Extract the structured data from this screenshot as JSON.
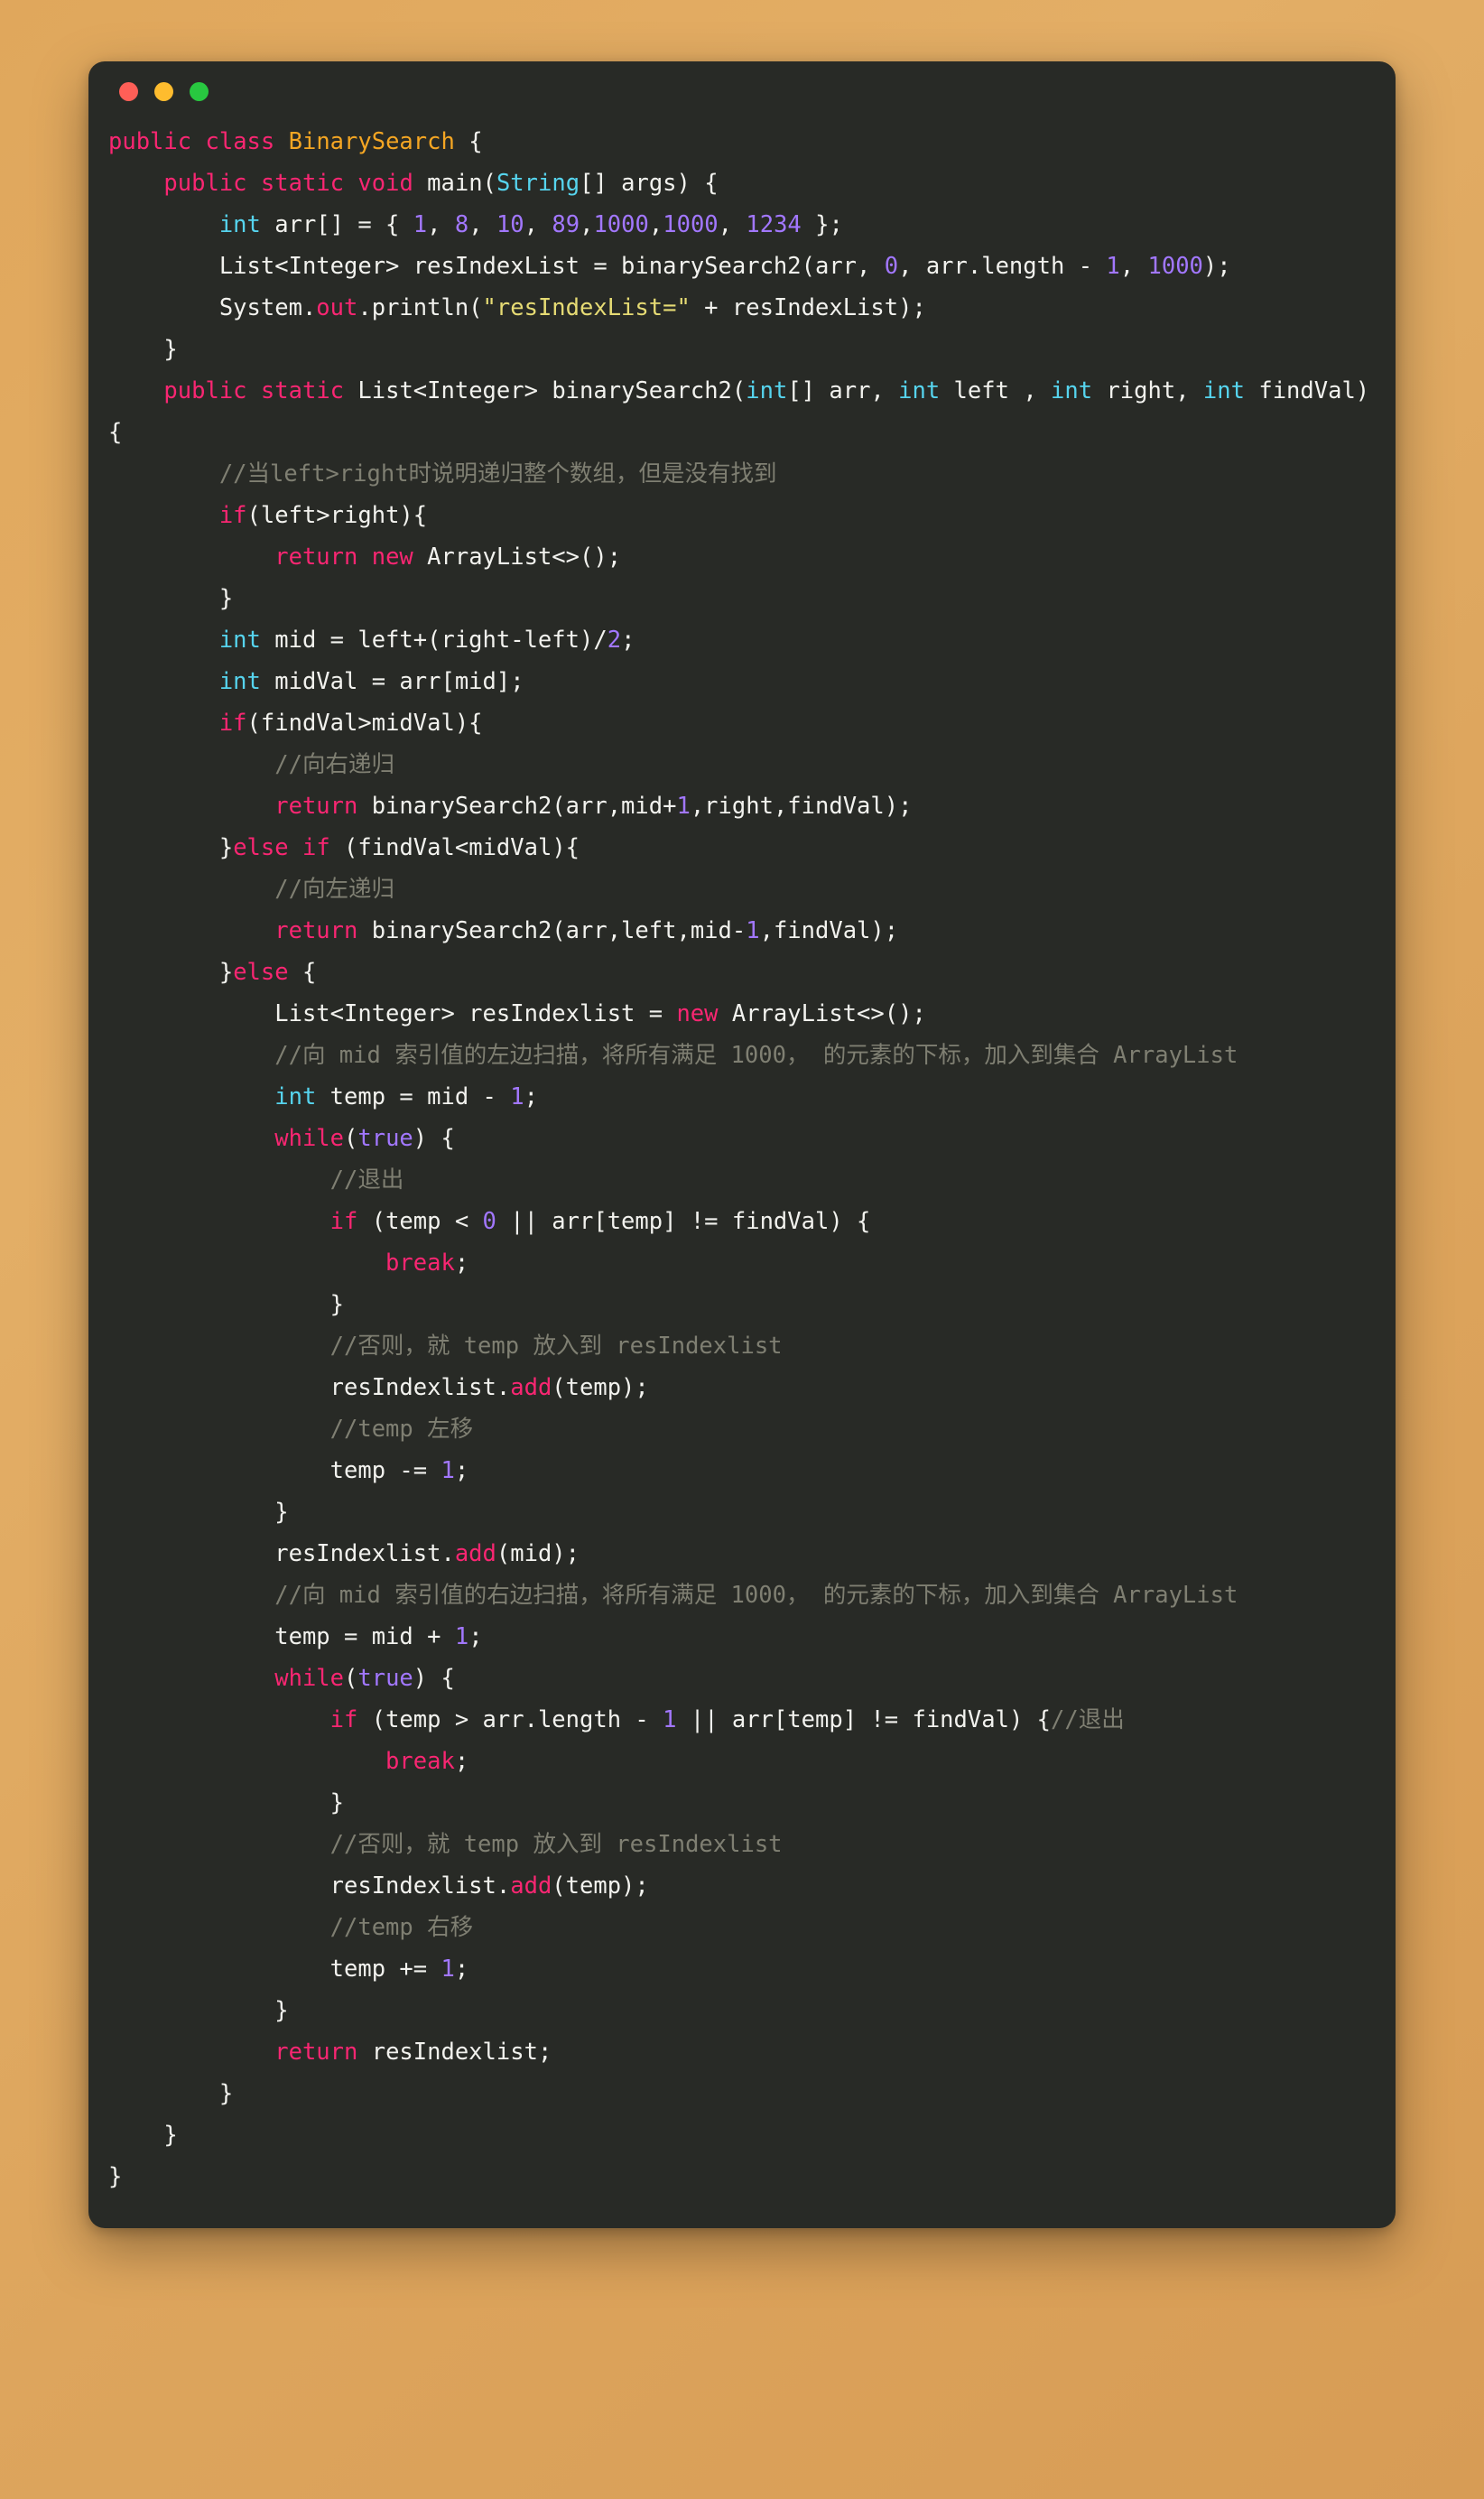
{
  "window": {
    "title": "",
    "controls": [
      {
        "name": "close",
        "color": "#ff5f57"
      },
      {
        "name": "minimize",
        "color": "#febc2e"
      },
      {
        "name": "maximize",
        "color": "#28c840"
      }
    ],
    "background_color": "#282a26",
    "page_background_color": "#e0a75c"
  },
  "theme": {
    "keyword": "#f92672",
    "type": "#56d4ee",
    "class_name": "#f5a623",
    "number": "#a277ff",
    "string": "#e6db74",
    "function": "#f92672",
    "comment": "#7f7f72",
    "plain": "#f2f2ee"
  },
  "language": "java",
  "code": {
    "lines": [
      [
        {
          "t": "public",
          "c": "kw"
        },
        {
          "t": " ",
          "c": "pln"
        },
        {
          "t": "class",
          "c": "kw"
        },
        {
          "t": " ",
          "c": "pln"
        },
        {
          "t": "BinarySearch",
          "c": "cls"
        },
        {
          "t": " {",
          "c": "pln"
        }
      ],
      [
        {
          "t": "    ",
          "c": "pln"
        },
        {
          "t": "public",
          "c": "kw"
        },
        {
          "t": " ",
          "c": "pln"
        },
        {
          "t": "static",
          "c": "kw"
        },
        {
          "t": " ",
          "c": "pln"
        },
        {
          "t": "void",
          "c": "kw"
        },
        {
          "t": " main(",
          "c": "pln"
        },
        {
          "t": "String",
          "c": "typ"
        },
        {
          "t": "[] args) {",
          "c": "pln"
        }
      ],
      [
        {
          "t": "        ",
          "c": "pln"
        },
        {
          "t": "int",
          "c": "typ"
        },
        {
          "t": " arr[] = { ",
          "c": "pln"
        },
        {
          "t": "1",
          "c": "num"
        },
        {
          "t": ", ",
          "c": "pln"
        },
        {
          "t": "8",
          "c": "num"
        },
        {
          "t": ", ",
          "c": "pln"
        },
        {
          "t": "10",
          "c": "num"
        },
        {
          "t": ", ",
          "c": "pln"
        },
        {
          "t": "89",
          "c": "num"
        },
        {
          "t": ",",
          "c": "pln"
        },
        {
          "t": "1000",
          "c": "num"
        },
        {
          "t": ",",
          "c": "pln"
        },
        {
          "t": "1000",
          "c": "num"
        },
        {
          "t": ", ",
          "c": "pln"
        },
        {
          "t": "1234",
          "c": "num"
        },
        {
          "t": " };",
          "c": "pln"
        }
      ],
      [
        {
          "t": "        List<Integer> resIndexList = binarySearch2(arr, ",
          "c": "pln"
        },
        {
          "t": "0",
          "c": "num"
        },
        {
          "t": ", arr.length - ",
          "c": "pln"
        },
        {
          "t": "1",
          "c": "num"
        },
        {
          "t": ", ",
          "c": "pln"
        },
        {
          "t": "1000",
          "c": "num"
        },
        {
          "t": ");",
          "c": "pln"
        }
      ],
      [
        {
          "t": "        System.",
          "c": "pln"
        },
        {
          "t": "out",
          "c": "fn"
        },
        {
          "t": ".println(",
          "c": "pln"
        },
        {
          "t": "\"resIndexList=\"",
          "c": "str"
        },
        {
          "t": " + resIndexList);",
          "c": "pln"
        }
      ],
      [
        {
          "t": "    }",
          "c": "pln"
        }
      ],
      [
        {
          "t": "    ",
          "c": "pln"
        },
        {
          "t": "public",
          "c": "kw"
        },
        {
          "t": " ",
          "c": "pln"
        },
        {
          "t": "static",
          "c": "kw"
        },
        {
          "t": " List<Integer> binarySearch2(",
          "c": "pln"
        },
        {
          "t": "int",
          "c": "typ"
        },
        {
          "t": "[] arr, ",
          "c": "pln"
        },
        {
          "t": "int",
          "c": "typ"
        },
        {
          "t": " left , ",
          "c": "pln"
        },
        {
          "t": "int",
          "c": "typ"
        },
        {
          "t": " right, ",
          "c": "pln"
        },
        {
          "t": "int",
          "c": "typ"
        },
        {
          "t": " findVal){",
          "c": "pln"
        }
      ],
      [
        {
          "t": "        ",
          "c": "pln"
        },
        {
          "t": "//当left>right时说明递归整个数组，但是没有找到",
          "c": "cmt"
        }
      ],
      [
        {
          "t": "        ",
          "c": "pln"
        },
        {
          "t": "if",
          "c": "kw"
        },
        {
          "t": "(left>right){",
          "c": "pln"
        }
      ],
      [
        {
          "t": "            ",
          "c": "pln"
        },
        {
          "t": "return",
          "c": "kw"
        },
        {
          "t": " ",
          "c": "pln"
        },
        {
          "t": "new",
          "c": "kw"
        },
        {
          "t": " ArrayList<>();",
          "c": "pln"
        }
      ],
      [
        {
          "t": "        }",
          "c": "pln"
        }
      ],
      [
        {
          "t": "        ",
          "c": "pln"
        },
        {
          "t": "int",
          "c": "typ"
        },
        {
          "t": " mid = left+(right-left)/",
          "c": "pln"
        },
        {
          "t": "2",
          "c": "num"
        },
        {
          "t": ";",
          "c": "pln"
        }
      ],
      [
        {
          "t": "        ",
          "c": "pln"
        },
        {
          "t": "int",
          "c": "typ"
        },
        {
          "t": " midVal = arr[mid];",
          "c": "pln"
        }
      ],
      [
        {
          "t": "        ",
          "c": "pln"
        },
        {
          "t": "if",
          "c": "kw"
        },
        {
          "t": "(findVal>midVal){",
          "c": "pln"
        }
      ],
      [
        {
          "t": "            ",
          "c": "pln"
        },
        {
          "t": "//向右递归",
          "c": "cmt"
        }
      ],
      [
        {
          "t": "            ",
          "c": "pln"
        },
        {
          "t": "return",
          "c": "kw"
        },
        {
          "t": " binarySearch2(arr,mid+",
          "c": "pln"
        },
        {
          "t": "1",
          "c": "num"
        },
        {
          "t": ",right,findVal);",
          "c": "pln"
        }
      ],
      [
        {
          "t": "        }",
          "c": "pln"
        },
        {
          "t": "else",
          "c": "kw"
        },
        {
          "t": " ",
          "c": "pln"
        },
        {
          "t": "if",
          "c": "kw"
        },
        {
          "t": " (findVal<midVal){",
          "c": "pln"
        }
      ],
      [
        {
          "t": "            ",
          "c": "pln"
        },
        {
          "t": "//向左递归",
          "c": "cmt"
        }
      ],
      [
        {
          "t": "            ",
          "c": "pln"
        },
        {
          "t": "return",
          "c": "kw"
        },
        {
          "t": " binarySearch2(arr,left,mid-",
          "c": "pln"
        },
        {
          "t": "1",
          "c": "num"
        },
        {
          "t": ",findVal);",
          "c": "pln"
        }
      ],
      [
        {
          "t": "        }",
          "c": "pln"
        },
        {
          "t": "else",
          "c": "kw"
        },
        {
          "t": " {",
          "c": "pln"
        }
      ],
      [
        {
          "t": "            List<Integer> resIndexlist = ",
          "c": "pln"
        },
        {
          "t": "new",
          "c": "kw"
        },
        {
          "t": " ArrayList<>();",
          "c": "pln"
        }
      ],
      [
        {
          "t": "            ",
          "c": "pln"
        },
        {
          "t": "//向 mid 索引值的左边扫描，将所有满足 1000， 的元素的下标，加入到集合 ArrayList",
          "c": "cmt"
        }
      ],
      [
        {
          "t": "            ",
          "c": "pln"
        },
        {
          "t": "int",
          "c": "typ"
        },
        {
          "t": " temp = mid - ",
          "c": "pln"
        },
        {
          "t": "1",
          "c": "num"
        },
        {
          "t": ";",
          "c": "pln"
        }
      ],
      [
        {
          "t": "            ",
          "c": "pln"
        },
        {
          "t": "while",
          "c": "kw"
        },
        {
          "t": "(",
          "c": "pln"
        },
        {
          "t": "true",
          "c": "num"
        },
        {
          "t": ") {",
          "c": "pln"
        }
      ],
      [
        {
          "t": "                ",
          "c": "pln"
        },
        {
          "t": "//退出",
          "c": "cmt"
        }
      ],
      [
        {
          "t": "                ",
          "c": "pln"
        },
        {
          "t": "if",
          "c": "kw"
        },
        {
          "t": " (temp < ",
          "c": "pln"
        },
        {
          "t": "0",
          "c": "num"
        },
        {
          "t": " || arr[temp] != findVal) {",
          "c": "pln"
        }
      ],
      [
        {
          "t": "                    ",
          "c": "pln"
        },
        {
          "t": "break",
          "c": "kw"
        },
        {
          "t": ";",
          "c": "pln"
        }
      ],
      [
        {
          "t": "                }",
          "c": "pln"
        }
      ],
      [
        {
          "t": "                ",
          "c": "pln"
        },
        {
          "t": "//否则，就 temp 放入到 resIndexlist",
          "c": "cmt"
        }
      ],
      [
        {
          "t": "                resIndexlist.",
          "c": "pln"
        },
        {
          "t": "add",
          "c": "fn"
        },
        {
          "t": "(temp);",
          "c": "pln"
        }
      ],
      [
        {
          "t": "                ",
          "c": "pln"
        },
        {
          "t": "//temp 左移",
          "c": "cmt"
        }
      ],
      [
        {
          "t": "                temp -= ",
          "c": "pln"
        },
        {
          "t": "1",
          "c": "num"
        },
        {
          "t": ";",
          "c": "pln"
        }
      ],
      [
        {
          "t": "            }",
          "c": "pln"
        }
      ],
      [
        {
          "t": "            resIndexlist.",
          "c": "pln"
        },
        {
          "t": "add",
          "c": "fn"
        },
        {
          "t": "(mid);",
          "c": "pln"
        }
      ],
      [
        {
          "t": "            ",
          "c": "pln"
        },
        {
          "t": "//向 mid 索引值的右边扫描，将所有满足 1000， 的元素的下标，加入到集合 ArrayList",
          "c": "cmt"
        }
      ],
      [
        {
          "t": "            temp = mid + ",
          "c": "pln"
        },
        {
          "t": "1",
          "c": "num"
        },
        {
          "t": ";",
          "c": "pln"
        }
      ],
      [
        {
          "t": "            ",
          "c": "pln"
        },
        {
          "t": "while",
          "c": "kw"
        },
        {
          "t": "(",
          "c": "pln"
        },
        {
          "t": "true",
          "c": "num"
        },
        {
          "t": ") {",
          "c": "pln"
        }
      ],
      [
        {
          "t": "                ",
          "c": "pln"
        },
        {
          "t": "if",
          "c": "kw"
        },
        {
          "t": " (temp > arr.length - ",
          "c": "pln"
        },
        {
          "t": "1",
          "c": "num"
        },
        {
          "t": " || arr[temp] != findVal) {",
          "c": "pln"
        },
        {
          "t": "//退出",
          "c": "cmt"
        }
      ],
      [
        {
          "t": "                    ",
          "c": "pln"
        },
        {
          "t": "break",
          "c": "kw"
        },
        {
          "t": ";",
          "c": "pln"
        }
      ],
      [
        {
          "t": "                }",
          "c": "pln"
        }
      ],
      [
        {
          "t": "                ",
          "c": "pln"
        },
        {
          "t": "//否则，就 temp 放入到 resIndexlist",
          "c": "cmt"
        }
      ],
      [
        {
          "t": "                resIndexlist.",
          "c": "pln"
        },
        {
          "t": "add",
          "c": "fn"
        },
        {
          "t": "(temp);",
          "c": "pln"
        }
      ],
      [
        {
          "t": "                ",
          "c": "pln"
        },
        {
          "t": "//temp 右移",
          "c": "cmt"
        }
      ],
      [
        {
          "t": "                temp += ",
          "c": "pln"
        },
        {
          "t": "1",
          "c": "num"
        },
        {
          "t": ";",
          "c": "pln"
        }
      ],
      [
        {
          "t": "            }",
          "c": "pln"
        }
      ],
      [
        {
          "t": "            ",
          "c": "pln"
        },
        {
          "t": "return",
          "c": "kw"
        },
        {
          "t": " resIndexlist;",
          "c": "pln"
        }
      ],
      [
        {
          "t": "        }",
          "c": "pln"
        }
      ],
      [
        {
          "t": "    }",
          "c": "pln"
        }
      ],
      [
        {
          "t": "}",
          "c": "pln"
        }
      ]
    ]
  }
}
